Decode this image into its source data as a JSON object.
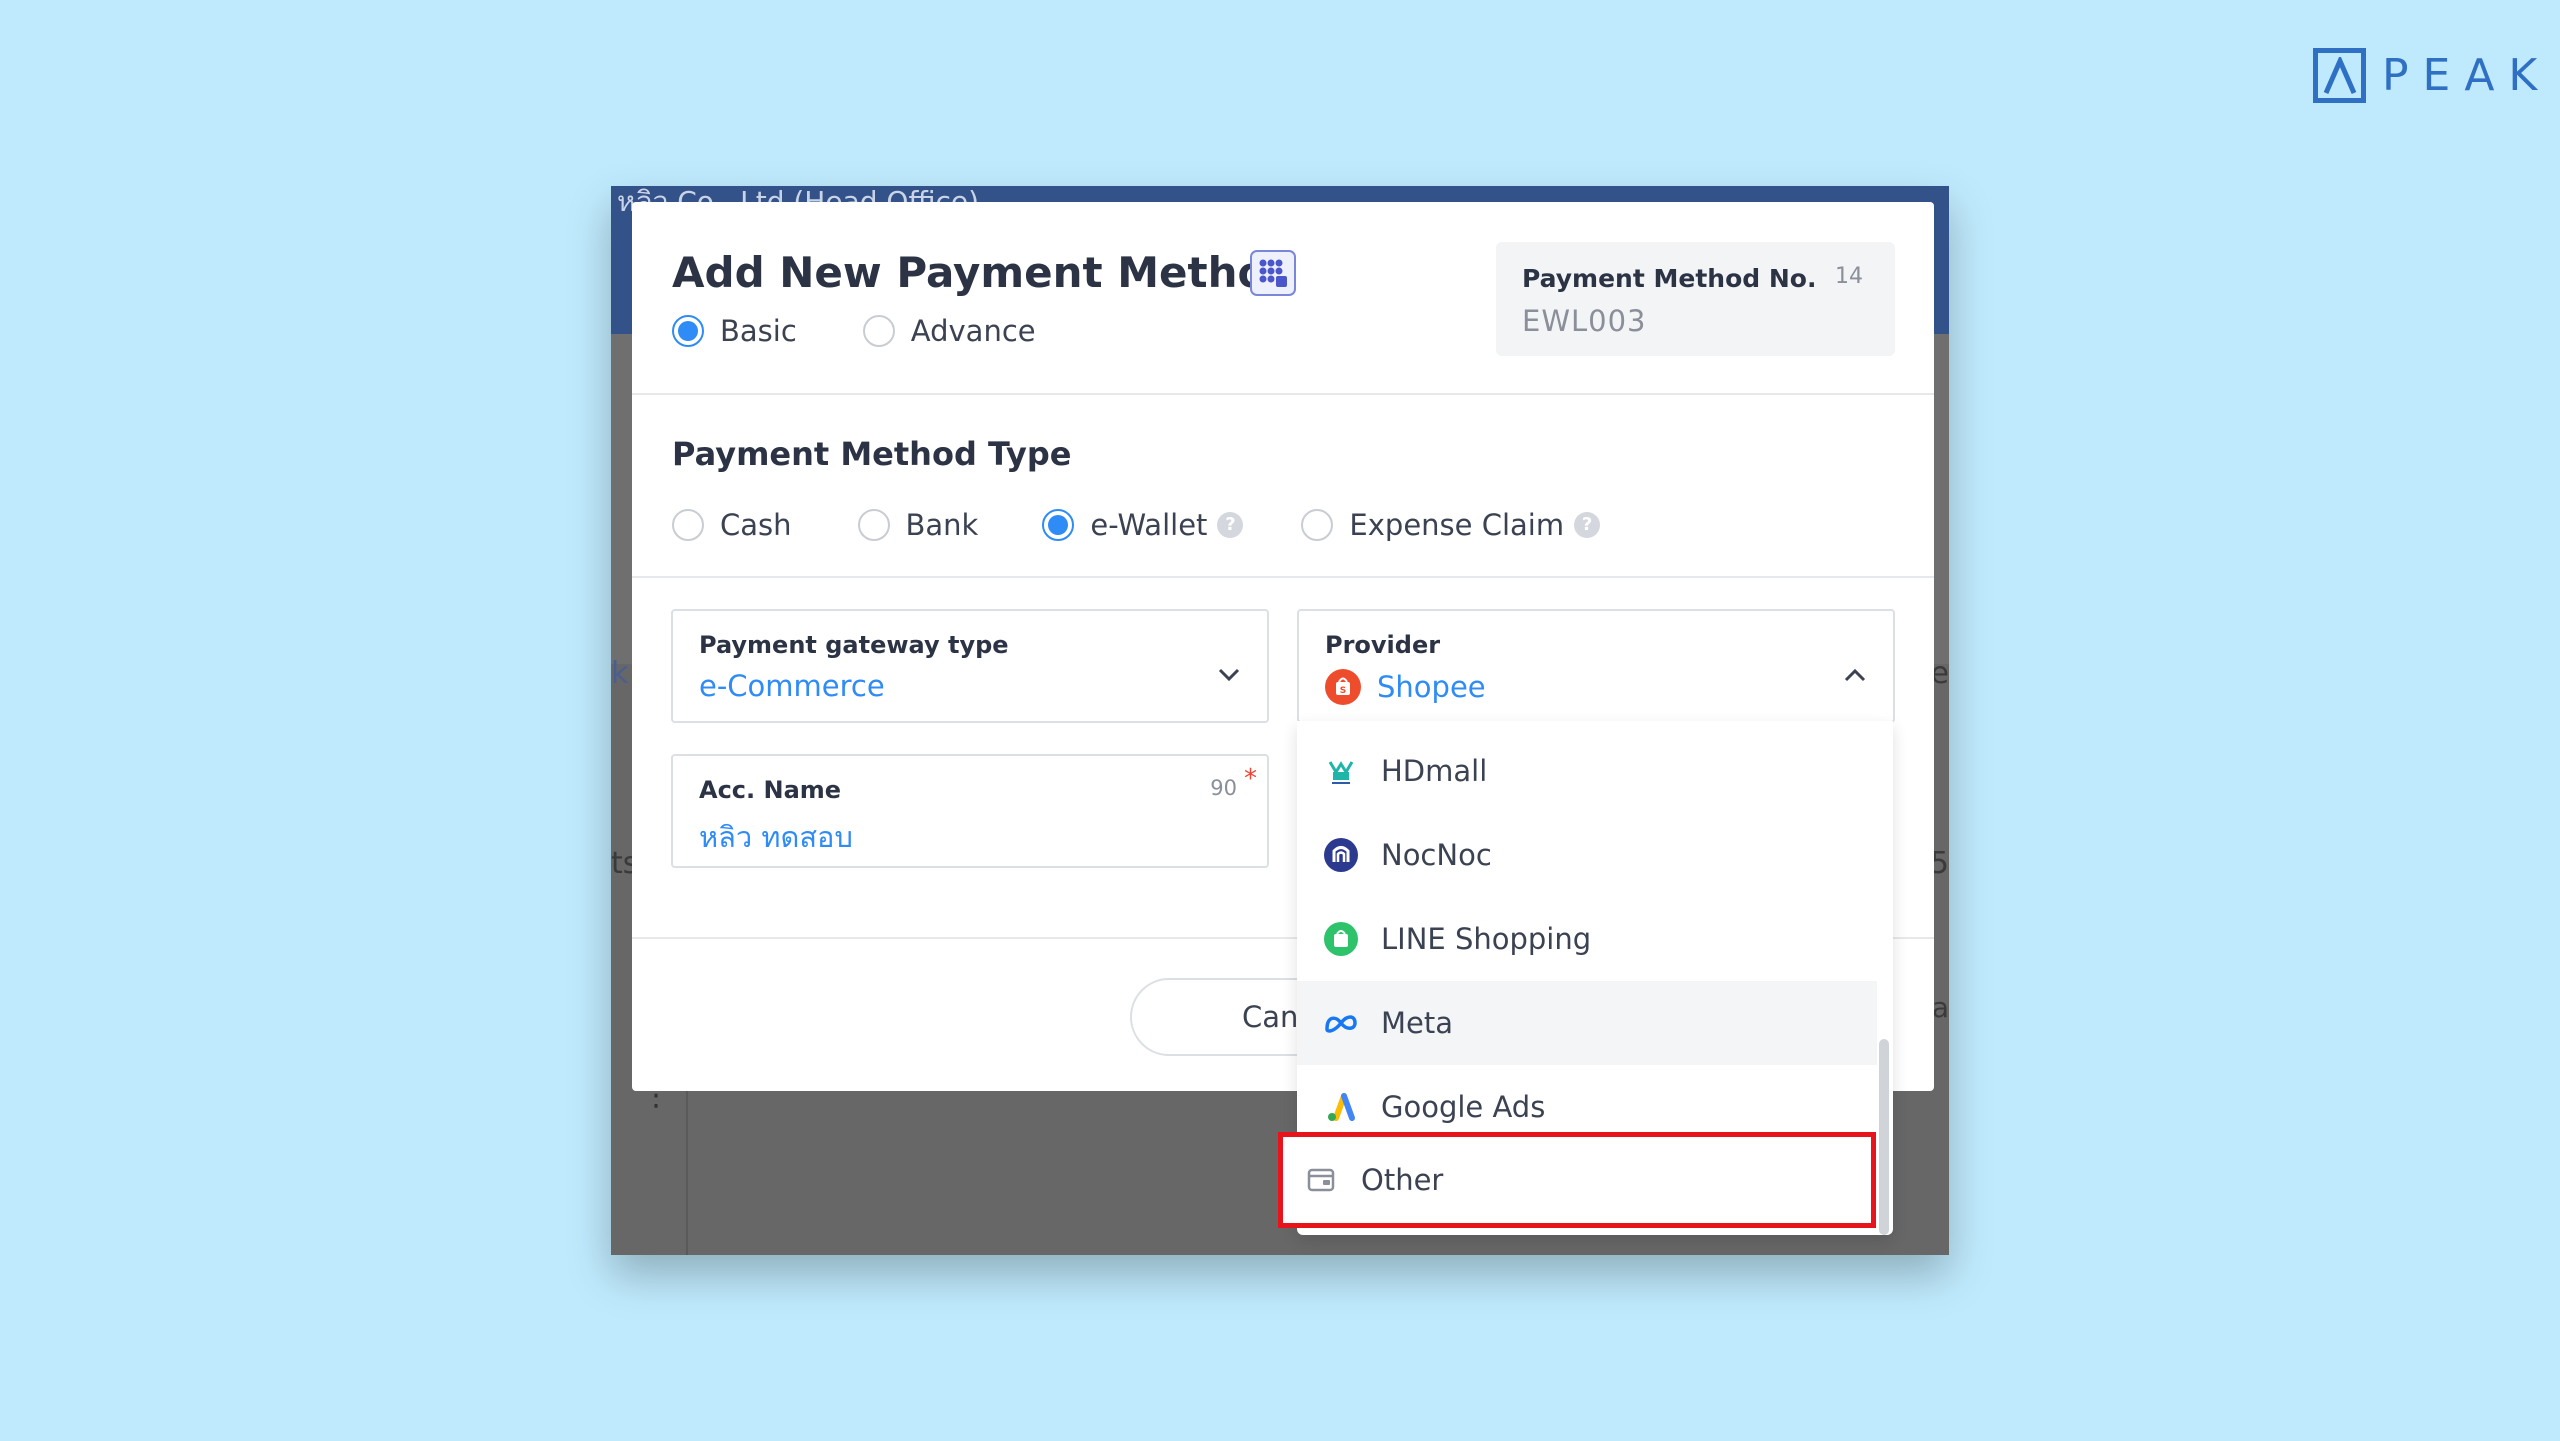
{
  "brand": {
    "name": "PEAK",
    "color": "#2f6fc4"
  },
  "background_app": {
    "header_text": "หลิว Co., Ltd (Head Office) ...",
    "edge_left_top": "k",
    "edge_left_mid": "ts",
    "edge_right_top": "e",
    "edge_right_mid": "5",
    "edge_right_low": "a"
  },
  "modal": {
    "title": "Add New Payment Method",
    "title_icon": "grid-apps-icon",
    "mode": {
      "options": [
        {
          "label": "Basic",
          "checked": true
        },
        {
          "label": "Advance",
          "checked": false
        }
      ]
    },
    "payment_method_no": {
      "label": "Payment Method No.",
      "count": "14",
      "value": "EWL003"
    },
    "type_section": {
      "title": "Payment Method Type",
      "options": [
        {
          "label": "Cash",
          "checked": false,
          "help": false
        },
        {
          "label": "Bank",
          "checked": false,
          "help": false
        },
        {
          "label": "e-Wallet",
          "checked": true,
          "help": true
        },
        {
          "label": "Expense Claim",
          "checked": false,
          "help": true
        }
      ],
      "help_glyph": "?"
    },
    "gateway": {
      "label": "Payment gateway type",
      "value": "e-Commerce",
      "icon": "chevron-down-icon"
    },
    "provider": {
      "label": "Provider",
      "value": "Shopee",
      "value_icon": "shopee-bag-icon",
      "icon": "chevron-up-icon"
    },
    "acc_name": {
      "label": "Acc. Name",
      "count": "90",
      "required_mark": "*",
      "value": "หลิว ทดสอบ"
    },
    "cancel_label": "Cancel"
  },
  "provider_dropdown": {
    "items": [
      {
        "label": "HDmall",
        "icon": "hdmall-icon"
      },
      {
        "label": "NocNoc",
        "icon": "nocnoc-icon"
      },
      {
        "label": "LINE Shopping",
        "icon": "line-shopping-icon"
      },
      {
        "label": "Meta",
        "icon": "meta-icon",
        "hover": true
      },
      {
        "label": "Google Ads",
        "icon": "google-ads-icon"
      }
    ],
    "highlighted_item": {
      "label": "Other",
      "icon": "wallet-icon"
    },
    "highlight_color": "#e8141c"
  },
  "colors": {
    "accent": "#2f8bf5",
    "background": "#bfeafd"
  }
}
